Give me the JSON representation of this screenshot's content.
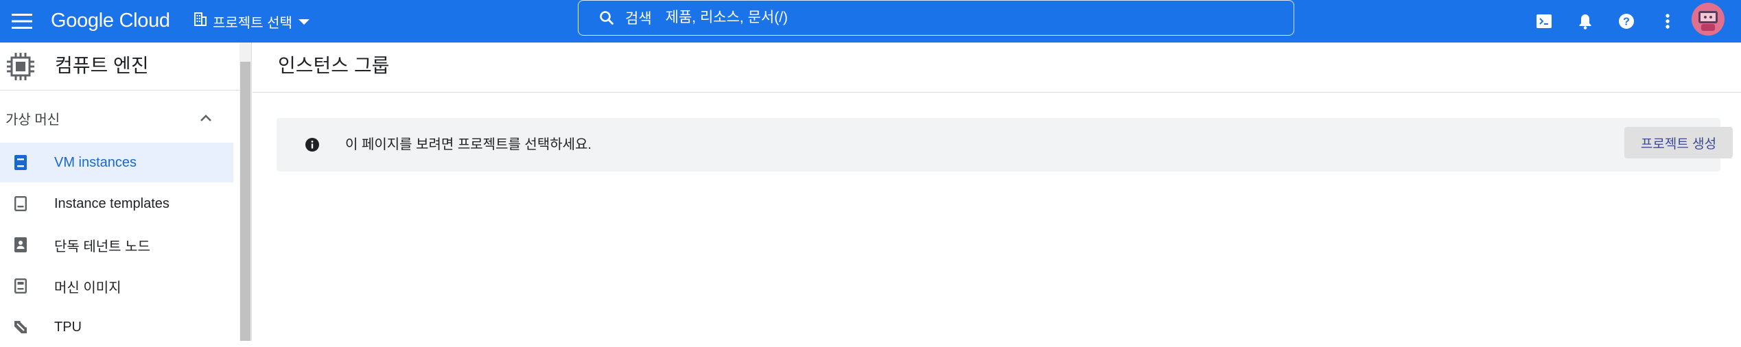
{
  "topbar": {
    "logo": "Google Cloud",
    "project_picker_label": "프로젝트 선택",
    "search_label": "검색",
    "search_placeholder": "제품, 리소스, 문서(/)",
    "icons": [
      "menu-icon",
      "grid-icon",
      "dropdown-arrow-icon",
      "search-icon",
      "cloud-shell-icon",
      "notifications-icon",
      "help-icon",
      "more-vert-icon",
      "avatar"
    ],
    "accent_color": "#1a73e8"
  },
  "sidenav": {
    "product_title": "컴퓨트 엔진",
    "section_label": "가상 머신",
    "items": [
      {
        "label": "VM instances",
        "icon": "vm-instances-icon",
        "active": true
      },
      {
        "label": "Instance templates",
        "icon": "instance-templates-icon",
        "active": false
      },
      {
        "label": "단독 테넌트 노드",
        "icon": "sole-tenant-nodes-icon",
        "active": false
      },
      {
        "label": "머신 이미지",
        "icon": "machine-images-icon",
        "active": false
      },
      {
        "label": "TPU",
        "icon": "tpu-icon",
        "active": false
      }
    ],
    "active_color": "#1967d2"
  },
  "main": {
    "page_title": "인스턴스 그룹",
    "banner": {
      "message": "이 페이지를 보려면 프로젝트를 선택하세요.",
      "button_label": "프로젝트 생성",
      "icon": "info-icon"
    }
  }
}
